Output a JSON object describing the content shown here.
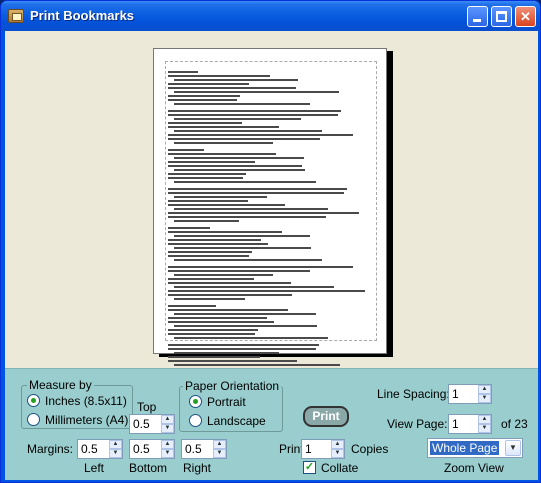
{
  "window": {
    "title": "Print Bookmarks",
    "minimize_icon": "minimize-icon",
    "maximize_icon": "maximize-icon",
    "close_icon": "close-x-icon",
    "close_glyph": "✕"
  },
  "preview": {
    "page_text_lines": 92
  },
  "measure": {
    "legend": "Measure by",
    "options": [
      {
        "label": "Inches (8.5x11)",
        "selected": true
      },
      {
        "label": "Millimeters (A4)",
        "selected": false
      }
    ]
  },
  "margins": {
    "label": "Margins:",
    "top_label": "Top",
    "top_value": "0.5",
    "left_label": "Left",
    "left_value": "0.5",
    "bottom_label": "Bottom",
    "bottom_value": "0.5",
    "right_label": "Right",
    "right_value": "0.5"
  },
  "orientation": {
    "legend": "Paper Orientation",
    "options": [
      {
        "label": "Portrait",
        "selected": true
      },
      {
        "label": "Landscape",
        "selected": false
      }
    ]
  },
  "print": {
    "button_label": "Print",
    "print_label": "Print",
    "copies_value": "1",
    "copies_label": "Copies",
    "collate_label": "Collate",
    "collate_checked": true
  },
  "view": {
    "line_spacing_label": "Line Spacing:",
    "line_spacing_value": "1",
    "view_page_label": "View Page:",
    "view_page_value": "1",
    "page_count_label": "of 23",
    "zoom_value": "Whole Page",
    "zoom_label": "Zoom View"
  },
  "colors": {
    "titlebar": "#0a5ee0",
    "preview_bg": "#ece9d8",
    "controls_bg": "#9acdcd",
    "print_button": "#8aa8a8"
  }
}
